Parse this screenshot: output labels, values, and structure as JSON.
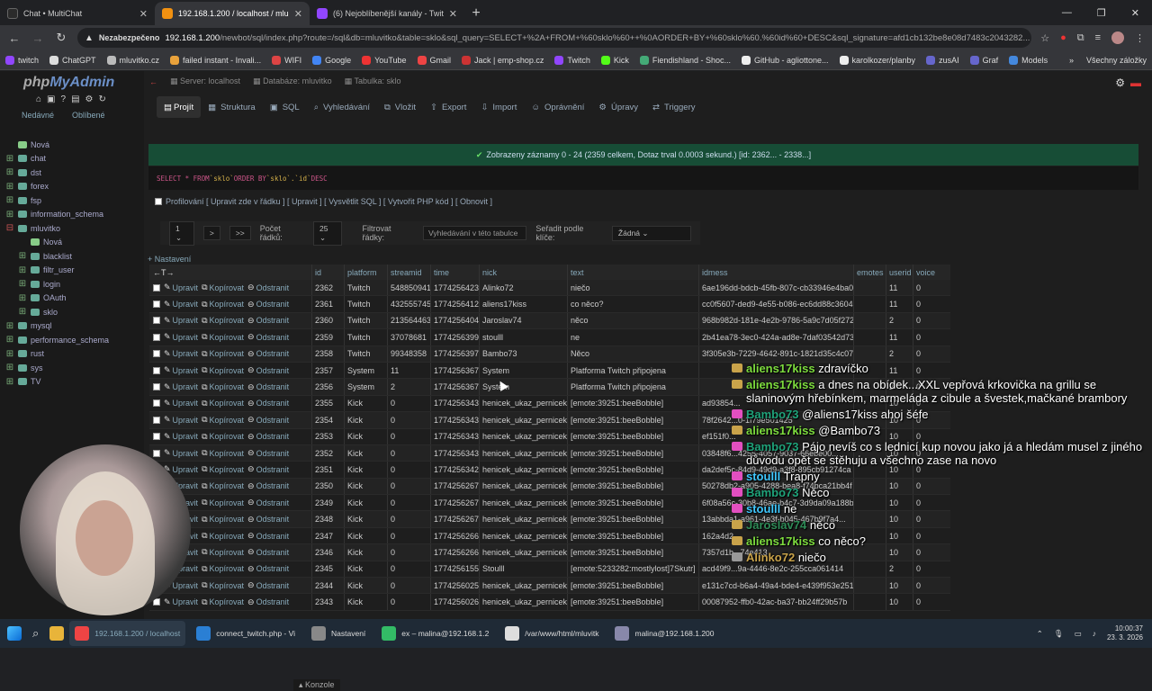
{
  "browser": {
    "tabs": [
      {
        "title": "Chat • MultiChat",
        "color": "#2b2b2b"
      },
      {
        "title": "192.168.1.200 / localhost / mlu",
        "color": "#f29111"
      },
      {
        "title": "(6) Nejoblíbenější kanály - Twit",
        "color": "#9146ff"
      }
    ],
    "security": "Nezabezpečeno",
    "url_host": "192.168.1.200",
    "url_path": "/newbot/sql/index.php?route=/sql&db=mluvitko&table=sklo&sql_query=SELECT+%2A+FROM+%60sklo%60++%0AORDER+BY+%60sklo%60.%60id%60+DESC&sql_signature=afd1cb132be8e08d7483c2043282...",
    "bookmarks": [
      {
        "label": "twitch",
        "color": "#9146ff"
      },
      {
        "label": "ChatGPT",
        "color": "#ddd"
      },
      {
        "label": "mluvitko.cz",
        "color": "#bbb"
      },
      {
        "label": "failed instant - Invali...",
        "color": "#e9a23b"
      },
      {
        "label": "WIFI",
        "color": "#d44"
      },
      {
        "label": "Google",
        "color": "#4285f4"
      },
      {
        "label": "YouTube",
        "color": "#e33"
      },
      {
        "label": "Gmail",
        "color": "#e44"
      },
      {
        "label": "Jack | emp-shop.cz",
        "color": "#c33"
      },
      {
        "label": "Twitch",
        "color": "#9146ff"
      },
      {
        "label": "Kick",
        "color": "#53fc18"
      },
      {
        "label": "Fiendishland - Shoc...",
        "color": "#4a7"
      },
      {
        "label": "GitHub - agliottone...",
        "color": "#eee"
      },
      {
        "label": "karolkozer/planby",
        "color": "#eee"
      },
      {
        "label": "zusAI",
        "color": "#66c"
      },
      {
        "label": "Graf",
        "color": "#66c"
      },
      {
        "label": "Models",
        "color": "#48d"
      }
    ],
    "all_bookmarks": "Všechny záložky"
  },
  "sidebar": {
    "logo_main": "php",
    "logo_accent": "MyAdmin",
    "tab_new": "Nedávné",
    "tab_fav": "Oblíbené",
    "tree": [
      {
        "label": "Nová",
        "level": 0,
        "sign": ""
      },
      {
        "label": "chat",
        "level": 0,
        "sign": "+"
      },
      {
        "label": "dst",
        "level": 0,
        "sign": "+"
      },
      {
        "label": "forex",
        "level": 0,
        "sign": "+"
      },
      {
        "label": "fsp",
        "level": 0,
        "sign": "+"
      },
      {
        "label": "information_schema",
        "level": 0,
        "sign": "+"
      },
      {
        "label": "mluvitko",
        "level": 0,
        "sign": "-"
      },
      {
        "label": "Nová",
        "level": 1,
        "sign": ""
      },
      {
        "label": "blacklist",
        "level": 1,
        "sign": "+"
      },
      {
        "label": "filtr_user",
        "level": 1,
        "sign": "+"
      },
      {
        "label": "login",
        "level": 1,
        "sign": "+"
      },
      {
        "label": "OAuth",
        "level": 1,
        "sign": "+"
      },
      {
        "label": "sklo",
        "level": 1,
        "sign": "+"
      },
      {
        "label": "mysql",
        "level": 0,
        "sign": "+"
      },
      {
        "label": "performance_schema",
        "level": 0,
        "sign": "+"
      },
      {
        "label": "rust",
        "level": 0,
        "sign": "+"
      },
      {
        "label": "sys",
        "level": 0,
        "sign": "+"
      },
      {
        "label": "TV",
        "level": 0,
        "sign": "+"
      }
    ]
  },
  "breadcrumb": {
    "server": "Server: localhost",
    "db": "Databáze: mluvitko",
    "table": "Tabulka: sklo"
  },
  "menu_tabs": [
    "Projít",
    "Struktura",
    "SQL",
    "Vyhledávání",
    "Vložit",
    "Export",
    "Import",
    "Oprávnění",
    "Úpravy",
    "Triggery"
  ],
  "success_msg": "Zobrazeny záznamy 0 - 24 (2359 celkem, Dotaz trval 0.0003 sekund.) [id: 2362... - 2338...]",
  "sql": {
    "kw1": "SELECT * FROM ",
    "t1": "`sklo`",
    "kw2": " ORDER BY ",
    "t2": "`sklo`.`id`",
    "kw3": " DESC"
  },
  "links": "Profilování [ Upravit zde v řádku ] [ Upravit ] [ Vysvětlit SQL ] [ Vytvořit PHP kód ] [ Obnovit ]",
  "filter": {
    "page": "1",
    "next": ">",
    "last": ">>",
    "rows_label": "Počet řádků:",
    "rows_value": "25",
    "filter_label": "Filtrovat řádky:",
    "search_placeholder": "Vyhledávání v této tabulce",
    "sort_label": "Seřadit podle klíče:",
    "sort_value": "Žádná"
  },
  "nastaveni": "+ Nastavení",
  "table": {
    "resize_arrows": "←T→",
    "headers": [
      "id",
      "platform",
      "streamid",
      "time",
      "nick",
      "text",
      "idmess",
      "emotes",
      "userid",
      "voice"
    ],
    "action_edit": "Upravit",
    "action_copy": "Kopírovat",
    "action_delete": "Odstranit",
    "rows": [
      [
        "2362",
        "Twitch",
        "548850941",
        "1774256423",
        "Alinko72",
        "niečo",
        "6ae196dd-bdcb-45fb-807c-cb33946e4ba0",
        "",
        "11",
        "0"
      ],
      [
        "2361",
        "Twitch",
        "432555745",
        "1774256412",
        "aliens17kiss",
        "co něco?",
        "cc0f5607-ded9-4e55-b086-ec6dd88c3604",
        "",
        "11",
        "0"
      ],
      [
        "2360",
        "Twitch",
        "213564463",
        "1774256404",
        "Jaroslav74",
        "něco",
        "968b982d-181e-4e2b-9786-5a9c7d05f272",
        "",
        "2",
        "0"
      ],
      [
        "2359",
        "Twitch",
        "37078681",
        "1774256399",
        "stoulll",
        "ne",
        "2b41ea78-3ec0-424a-ad8e-7daf03542d73",
        "",
        "11",
        "0"
      ],
      [
        "2358",
        "Twitch",
        "99348358",
        "1774256397",
        "Bambo73",
        "Něco",
        "3f305e3b-7229-4642-891c-1821d35c4c07",
        "",
        "2",
        "0"
      ],
      [
        "2357",
        "System",
        "11",
        "1774256367",
        "System",
        "Platforma Twitch připojena",
        "",
        "",
        "11",
        "0"
      ],
      [
        "2356",
        "System",
        "2",
        "1774256367",
        "System",
        "Platforma Twitch připojena",
        "",
        "",
        "2",
        "0"
      ],
      [
        "2355",
        "Kick",
        "0",
        "1774256343",
        "henicek_ukaz_pernicek",
        "[emote:39251:beeBobble]",
        "ad93854...",
        "",
        "10",
        "0"
      ],
      [
        "2354",
        "Kick",
        "0",
        "1774256343",
        "henicek_ukaz_pernicek",
        "[emote:39251:beeBobble]",
        "78f2642...0-1f79e501425",
        "",
        "10",
        "0"
      ],
      [
        "2353",
        "Kick",
        "0",
        "1774256343",
        "henicek_ukaz_pernicek",
        "[emote:39251:beeBobble]",
        "ef151f0...",
        "",
        "10",
        "0"
      ],
      [
        "2352",
        "Kick",
        "0",
        "1774256343",
        "henicek_ukaz_pernicek",
        "[emote:39251:beeBobble]",
        "03848f6...4255-4057-9037-66ebe00...",
        "",
        "10",
        "0"
      ],
      [
        "2351",
        "Kick",
        "0",
        "1774256342",
        "henicek_ukaz_pernicek",
        "[emote:39251:beeBobble]",
        "da2def5c-84d9-49d9-a3f8-895cb91274ca",
        "",
        "10",
        "0"
      ],
      [
        "2350",
        "Kick",
        "0",
        "1774256267",
        "henicek_ukaz_pernicek",
        "[emote:39251:beeBobble]",
        "50278db2-a905-4288-bea8-f74bca21bb4f",
        "",
        "10",
        "0"
      ],
      [
        "2349",
        "Kick",
        "0",
        "1774256267",
        "henicek_ukaz_pernicek",
        "[emote:39251:beeBobble]",
        "6f08a56c-30b8-46ae-b4c7-3d9da09a188b",
        "",
        "10",
        "0"
      ],
      [
        "2348",
        "Kick",
        "0",
        "1774256267",
        "henicek_ukaz_pernicek",
        "[emote:39251:beeBobble]",
        "13abbda1-a961-4e3f-b045-467b9f7a4...",
        "",
        "10",
        "0"
      ],
      [
        "2347",
        "Kick",
        "0",
        "1774256266",
        "henicek_ukaz_pernicek",
        "[emote:39251:beeBobble]",
        "162a4d2...",
        "",
        "10",
        "0"
      ],
      [
        "2346",
        "Kick",
        "0",
        "1774256266",
        "henicek_ukaz_pernicek",
        "[emote:39251:beeBobble]",
        "7357d1b...74e413",
        "",
        "10",
        "0"
      ],
      [
        "2345",
        "Kick",
        "0",
        "1774256155",
        "Stoulll",
        "[emote:5233282:mostlylost]7Skutr]",
        "acd49f9...9a-4446-8e2c-255cca061414",
        "",
        "2",
        "0"
      ],
      [
        "2344",
        "Kick",
        "0",
        "1774256025",
        "henicek_ukaz_pernicek",
        "[emote:39251:beeBobble]",
        "e131c7cd-b6a4-49a4-bde4-e439f953e251",
        "",
        "10",
        "0"
      ],
      [
        "2343",
        "Kick",
        "0",
        "1774256026",
        "henicek_ukaz_pernicek",
        "[emote:39251:beeBobble]",
        "00087952-ffb0-42ac-ba37-bb24ff29b57b",
        "",
        "10",
        "0"
      ]
    ]
  },
  "chat": [
    {
      "nick": "aliens17kiss",
      "color": "#7ddc3e",
      "badge": "#c9a34a",
      "text": "zdravíčko"
    },
    {
      "nick": "aliens17kiss",
      "color": "#7ddc3e",
      "badge": "#c9a34a",
      "text": "a dnes na obídek...XXL vepřová krkovička na grillu se slaninovým hřebínkem, marmeláda z cibule a švestek,mačkané brambory"
    },
    {
      "nick": "Bambo73",
      "color": "#1fa37a",
      "badge": "#e24fc0",
      "text": "@aliens17kiss ahoj šéfe"
    },
    {
      "nick": "aliens17kiss",
      "color": "#7ddc3e",
      "badge": "#c9a34a",
      "text": "@Bambo73"
    },
    {
      "nick": "Bambo73",
      "color": "#1fa37a",
      "badge": "#e24fc0",
      "text": "Pájo nevíš co s lednicí kup novou jako já a hledám musel z jiného důvodu opět se stěhuju a všechno zase na novo"
    },
    {
      "nick": "stoulll",
      "color": "#3fc8ff",
      "badge": "#e24fc0",
      "text": "Trapny"
    },
    {
      "nick": "Bambo73",
      "color": "#1fa37a",
      "badge": "#e24fc0",
      "text": "Něco"
    },
    {
      "nick": "stoulll",
      "color": "#3fc8ff",
      "badge": "#e24fc0",
      "text": "ne"
    },
    {
      "nick": "Jaroslav74",
      "color": "#2e8b57",
      "badge": "#c9a34a",
      "text": "něco"
    },
    {
      "nick": "aliens17kiss",
      "color": "#7ddc3e",
      "badge": "#c9a34a",
      "text": "co něco?"
    },
    {
      "nick": "Alinko72",
      "color": "#c9a34a",
      "badge": "#999999",
      "text": "niečo"
    }
  ],
  "konzole": "Konzole",
  "taskbar": {
    "items": [
      {
        "label": "192.168.1.200 / localhost",
        "color": "#e44",
        "active": true
      },
      {
        "label": "connect_twitch.php - Vi",
        "color": "#2a7fd4",
        "active": false
      },
      {
        "label": "Nastavení",
        "color": "#888",
        "active": false
      },
      {
        "label": "ex – malina@192.168.1.2",
        "color": "#3b6",
        "active": false
      },
      {
        "label": "/var/www/html/mluvitk",
        "color": "#ddd",
        "active": false
      },
      {
        "label": "malina@192.168.1.200",
        "color": "#88a",
        "active": false
      }
    ],
    "time": "10:00:37",
    "date": "23. 3. 2026"
  }
}
